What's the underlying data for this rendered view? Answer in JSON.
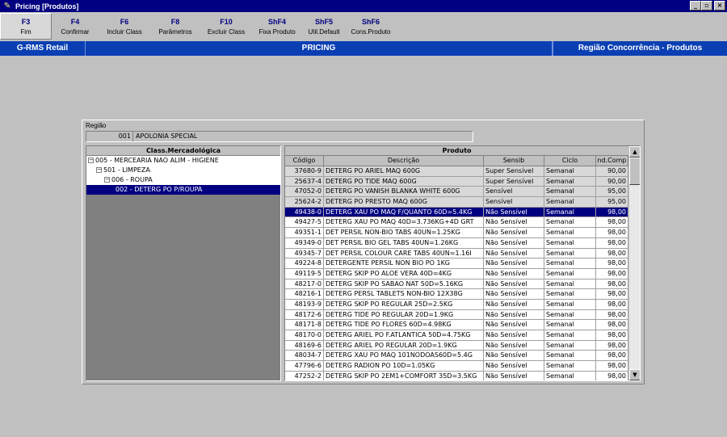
{
  "window": {
    "title": "Pricing [Produtos]",
    "buttons": {
      "minimize": "_",
      "maximize": "▫",
      "close": "×"
    }
  },
  "toolbar": [
    {
      "key": "F3",
      "label": "Fim"
    },
    {
      "key": "F4",
      "label": "Confirmar"
    },
    {
      "key": "F6",
      "label": "Incluir Class"
    },
    {
      "key": "F8",
      "label": "Parâmetros"
    },
    {
      "key": "F10",
      "label": "Excluir Class"
    },
    {
      "key": "ShF4",
      "label": "Fixa Produto"
    },
    {
      "key": "ShF5",
      "label": "Util.Default"
    },
    {
      "key": "ShF6",
      "label": "Cons.Produto"
    }
  ],
  "header": {
    "left": "G-RMS Retail",
    "center": "PRICING",
    "right": "Região Concorrência - Produtos"
  },
  "regiao": {
    "label": "Região",
    "code": "001",
    "name": "APOLONIA SPECIAL"
  },
  "tree": {
    "header": "Class.Mercadológica",
    "nodes": [
      {
        "expander": "−",
        "text": "005 - MERCEARIA NAO ALIM - HIGIENE"
      },
      {
        "expander": "−",
        "text": "501 - LIMPEZA"
      },
      {
        "expander": "−",
        "text": "006 - ROUPA"
      },
      {
        "expander": "",
        "text": "002 - DETERG PO P/ROUPA"
      }
    ]
  },
  "grid": {
    "title": "Produto",
    "columns": [
      "Código",
      "Descrição",
      "Sensib",
      "Ciclo",
      "nd.Comp"
    ],
    "rows": [
      [
        "37680-9",
        "DETERG PO ARIEL MAQ 600G",
        "Super Sensível",
        "Semanal",
        "90,00"
      ],
      [
        "25637-4",
        "DETERG PO TIDE MAQ 600G",
        "Super Sensível",
        "Semanal",
        "90,00"
      ],
      [
        "47052-0",
        "DETERG PO VANISH BLANKA WHITE 600G",
        "Sensível",
        "Semanal",
        "95,00"
      ],
      [
        "25624-2",
        "DETERG PO PRESTO MAQ 600G",
        "Sensível",
        "Semanal",
        "95,00"
      ],
      [
        "49438-0",
        "DETERG XAU PO MAQ F/QUANTO 60D=5.4KG",
        "Não Sensível",
        "Semanal",
        "98,00"
      ],
      [
        "49427-5",
        "DETERG XAU PO MAQ 40D=3.736KG+4D GRT",
        "Não Sensível",
        "Semanal",
        "98,00"
      ],
      [
        "49351-1",
        "DET PERSIL NON-BIO TABS 40UN=1.25KG",
        "Não Sensível",
        "Semanal",
        "98,00"
      ],
      [
        "49349-0",
        "DET PERSIL BIO GEL TABS 40UN=1.26KG",
        "Não Sensível",
        "Semanal",
        "98,00"
      ],
      [
        "49345-7",
        "DET PERSIL COLOUR CARE TABS 40UN=1.16I",
        "Não Sensível",
        "Semanal",
        "98,00"
      ],
      [
        "49224-8",
        "DETERGENTE PERSIL NON BIO PO 1KG",
        "Não Sensível",
        "Semanal",
        "98,00"
      ],
      [
        "49119-5",
        "DETERG SKIP PO ALOE VERA 40D=4KG",
        "Não Sensível",
        "Semanal",
        "98,00"
      ],
      [
        "48217-0",
        "DETERG SKIP PO SABAO NAT 50D=5.16KG",
        "Não Sensível",
        "Semanal",
        "98,00"
      ],
      [
        "48216-1",
        "DETERG PERSL TABLETS NON-BIO 12X38G",
        "Não Sensível",
        "Semanal",
        "98,00"
      ],
      [
        "48193-9",
        "DETERG SKIP PO REGULAR 25D=2.5KG",
        "Não Sensível",
        "Semanal",
        "98,00"
      ],
      [
        "48172-6",
        "DETERG TIDE PO REGULAR 20D=1.9KG",
        "Não Sensível",
        "Semanal",
        "98,00"
      ],
      [
        "48171-8",
        "DETERG TIDE PO FLORES 60D=4.98KG",
        "Não Sensível",
        "Semanal",
        "98,00"
      ],
      [
        "48170-0",
        "DETERG ARIEL PO F.ATLANTICA 50D=4.75KG",
        "Não Sensível",
        "Semanal",
        "98,00"
      ],
      [
        "48169-6",
        "DETERG ARIEL PO REGULAR 20D=1.9KG",
        "Não Sensível",
        "Semanal",
        "98,00"
      ],
      [
        "48034-7",
        "DETERG XAU PO MAQ 101NODOAS60D=5.4G",
        "Não Sensível",
        "Semanal",
        "98,00"
      ],
      [
        "47796-6",
        "DETERG RADION PO 10D=1.05KG",
        "Não Sensível",
        "Semanal",
        "98,00"
      ],
      [
        "47252-2",
        "DETERG SKIP PO 2EM1+COMFORT 35D=3.5KG",
        "Não Sensível",
        "Semanal",
        "98,00"
      ]
    ]
  },
  "scrollbar": {
    "up": "▲",
    "down": "▼"
  }
}
